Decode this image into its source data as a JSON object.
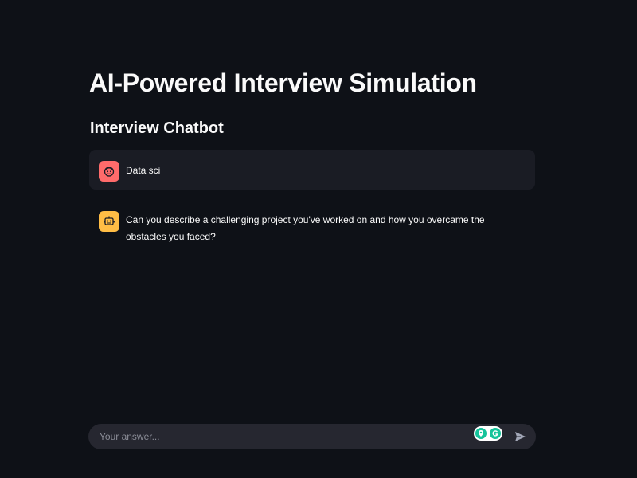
{
  "header": {
    "title": "AI-Powered Interview Simulation",
    "subtitle": "Interview Chatbot"
  },
  "chat": {
    "messages": [
      {
        "role": "user",
        "avatar_icon": "user-face-icon",
        "text": "Data sci"
      },
      {
        "role": "assistant",
        "avatar_icon": "robot-icon",
        "text": "Can you describe a challenging project you've worked on and how you overcame the obstacles you faced?"
      }
    ]
  },
  "input": {
    "placeholder": "Your answer...",
    "value": "",
    "send_icon": "send-icon",
    "extension_icons": [
      "location-pin-icon",
      "grammarly-icon"
    ]
  },
  "colors": {
    "background": "#0e1117",
    "user_message_bg": "#1a1c24",
    "user_avatar": "#ff6b6b",
    "assistant_avatar": "#ffbd45",
    "input_bg": "#262730",
    "text": "#fafafa"
  }
}
